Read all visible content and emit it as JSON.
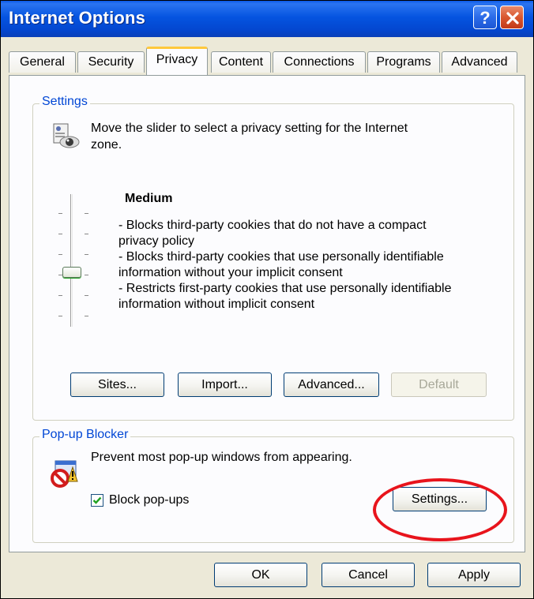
{
  "window": {
    "title": "Internet Options",
    "help_button": "?",
    "close_button": "X"
  },
  "tabs": [
    {
      "label": "General"
    },
    {
      "label": "Security"
    },
    {
      "label": "Privacy"
    },
    {
      "label": "Content"
    },
    {
      "label": "Connections"
    },
    {
      "label": "Programs"
    },
    {
      "label": "Advanced"
    }
  ],
  "active_tab": "Privacy",
  "settings_group": {
    "title": "Settings",
    "description_line1": "Move the slider to select a privacy setting for the Internet",
    "description_line2": "zone.",
    "level_title": "Medium",
    "level_lines": [
      "- Blocks third-party cookies that do not have a compact",
      "privacy policy",
      "- Blocks third-party cookies that use personally identifiable",
      "information without your implicit consent",
      "- Restricts first-party cookies that use personally identifiable",
      "information without implicit consent"
    ],
    "buttons": {
      "sites": "Sites...",
      "import": "Import...",
      "advanced": "Advanced...",
      "default": "Default"
    }
  },
  "popup_group": {
    "title": "Pop-up Blocker",
    "description": "Prevent most pop-up windows from appearing.",
    "checkbox_label": "Block pop-ups",
    "checkbox_checked": true,
    "settings_button": "Settings..."
  },
  "footer": {
    "ok": "OK",
    "cancel": "Cancel",
    "apply": "Apply"
  },
  "colors": {
    "title_bar": "#0554e0",
    "group_title": "#0046d5",
    "annotation_circle": "#e8141c",
    "checkmark": "#21a121"
  }
}
